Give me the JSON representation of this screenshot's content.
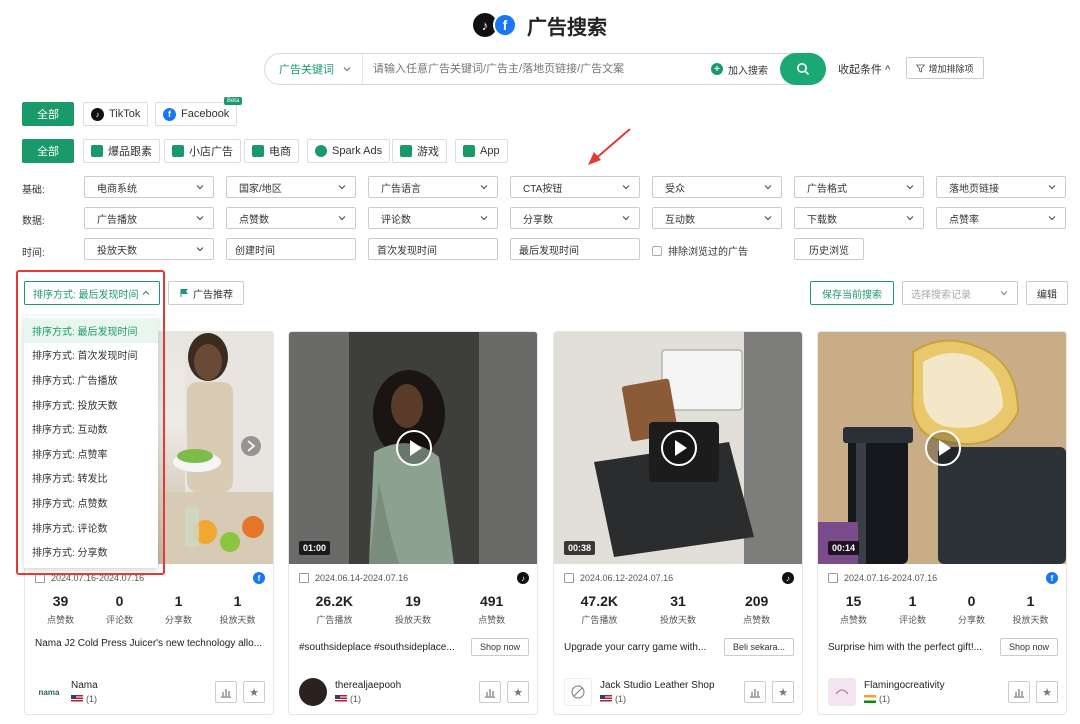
{
  "header": {
    "title": "广告搜索"
  },
  "search": {
    "type_label": "广告关键词",
    "placeholder": "请输入任意广告关键词/广告主/落地页链接/广告文案",
    "add_label": "加入搜索",
    "collapse_label": "收起条件",
    "exclude_label": "增加排除项"
  },
  "platform_tabs": {
    "all": "全部",
    "tiktok": "TikTok",
    "facebook": "Facebook",
    "beta": "Beta"
  },
  "category_tabs": {
    "all": "全部",
    "items": [
      "爆品跟素",
      "小店广告",
      "电商",
      "Spark Ads",
      "游戏",
      "App"
    ]
  },
  "filters": {
    "basic_label": "基础:",
    "basic": [
      "电商系统",
      "国家/地区",
      "广告语言",
      "CTA按钮",
      "受众",
      "广告格式",
      "落地页链接"
    ],
    "data_label": "数据:",
    "data": [
      "广告播放",
      "点赞数",
      "评论数",
      "分享数",
      "互动数",
      "下载数",
      "点赞率"
    ],
    "time_label": "时间:",
    "time_dropdown": "投放天数",
    "time_inputs": [
      "创建时间",
      "首次发现时间",
      "最后发现时间"
    ],
    "exclude_viewed": "排除浏览过的广告",
    "history": "历史浏览"
  },
  "toolbar": {
    "sort_label": "排序方式: 最后发现时间",
    "recommend_label": "广告推荐",
    "save_label": "保存当前搜索",
    "record_placeholder": "选择搜索记录",
    "edit_label": "编辑"
  },
  "sort_options": [
    "排序方式: 最后发现时间",
    "排序方式: 首次发现时间",
    "排序方式: 广告播放",
    "排序方式: 投放天数",
    "排序方式: 互动数",
    "排序方式: 点赞率",
    "排序方式: 转发比",
    "排序方式: 点赞数",
    "排序方式: 评论数",
    "排序方式: 分享数"
  ],
  "cards": [
    {
      "date": "2024.07.16-2024.07.16",
      "platform": "facebook",
      "duration": "",
      "stats": [
        {
          "value": "39",
          "label": "点赞数"
        },
        {
          "value": "0",
          "label": "评论数"
        },
        {
          "value": "1",
          "label": "分享数"
        },
        {
          "value": "1",
          "label": "投放天数"
        }
      ],
      "desc": "Nama J2 Cold Press Juicer's new technology allo...",
      "cta": "",
      "author": "Nama",
      "avatar_text": "nama",
      "country": "(1)",
      "flag": "us"
    },
    {
      "date": "2024.06.14-2024.07.16",
      "platform": "tiktok",
      "duration": "01:00",
      "stats": [
        {
          "value": "26.2K",
          "label": "广告播放"
        },
        {
          "value": "19",
          "label": "投放天数"
        },
        {
          "value": "491",
          "label": "点赞数"
        }
      ],
      "desc": "#southsideplace #southsideplace...",
      "cta": "Shop now",
      "author": "therealjaepooh",
      "avatar_text": "",
      "country": "(1)",
      "flag": "us"
    },
    {
      "date": "2024.06.12-2024.07.16",
      "platform": "tiktok",
      "duration": "00:38",
      "stats": [
        {
          "value": "47.2K",
          "label": "广告播放"
        },
        {
          "value": "31",
          "label": "投放天数"
        },
        {
          "value": "209",
          "label": "点赞数"
        }
      ],
      "desc": "Upgrade your carry game with...",
      "cta": "Beli sekara...",
      "author": "Jack Studio Leather Shop",
      "avatar_text": "",
      "country": "(1)",
      "flag": "us"
    },
    {
      "date": "2024.07.16-2024.07.16",
      "platform": "facebook",
      "duration": "00:14",
      "stats": [
        {
          "value": "15",
          "label": "点赞数"
        },
        {
          "value": "1",
          "label": "评论数"
        },
        {
          "value": "0",
          "label": "分享数"
        },
        {
          "value": "1",
          "label": "投放天数"
        }
      ],
      "desc": "Surprise him with the perfect gift!...",
      "cta": "Shop now",
      "author": "Flamingocreativity",
      "avatar_text": "",
      "country": "(1)",
      "flag": "in"
    }
  ]
}
